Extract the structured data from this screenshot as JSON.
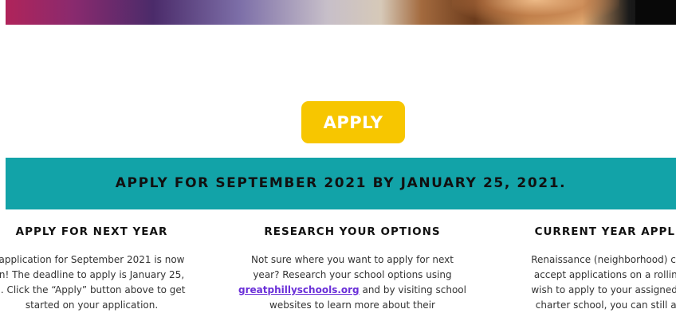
{
  "hero": {
    "image": "hero-photo-strip"
  },
  "apply_button": {
    "label": "APPLY",
    "color": "#f7c600"
  },
  "banner": {
    "title": "APPLY FOR SEPTEMBER 2021 BY JANUARY 25, 2021.",
    "color": "#12a3a8"
  },
  "columns": [
    {
      "heading": "APPLY FOR NEXT YEAR",
      "lines": [
        "application for September 2021 is now",
        "n! The deadline to apply is January 25,",
        "l. Click the “Apply” button above to get",
        "started on your application."
      ]
    },
    {
      "heading": "RESEARCH YOUR OPTIONS",
      "line_1": "Not sure where you want to apply for next",
      "line_2": "year? Research your school options using",
      "link": "greatphillyschools.org",
      "line_3_after_link": " and by visiting school",
      "line_4": "websites to learn more about their"
    },
    {
      "heading": "CURRENT YEAR APPLICA",
      "lines": [
        "Renaissance (neighborhood) charte",
        "accept applications on a rolling ba",
        "wish to apply to your assigned neig",
        "charter school, you can still apply"
      ]
    }
  ],
  "link_color": "#6a2fd8"
}
